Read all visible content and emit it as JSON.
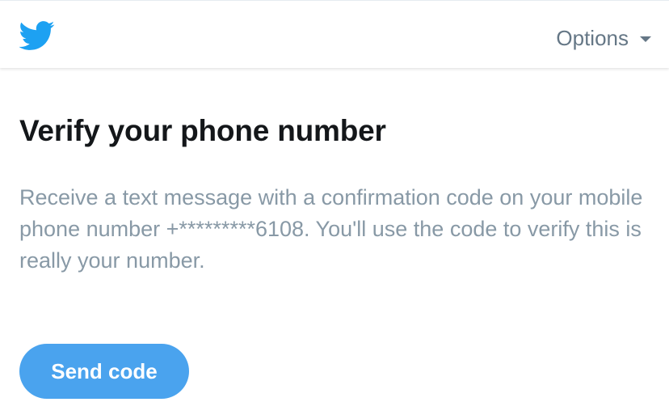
{
  "header": {
    "logo_icon": "twitter-bird-icon",
    "brand_color": "#1da1f2",
    "options_label": "Options",
    "options_icon": "caret-down-icon"
  },
  "main": {
    "title": "Verify your phone number",
    "description": "Receive a text message with a confirmation code on your mobile phone number +*********6108. You'll use the code to verify this is really your number.",
    "send_button_label": "Send code",
    "button_color": "#4aa3ee"
  }
}
